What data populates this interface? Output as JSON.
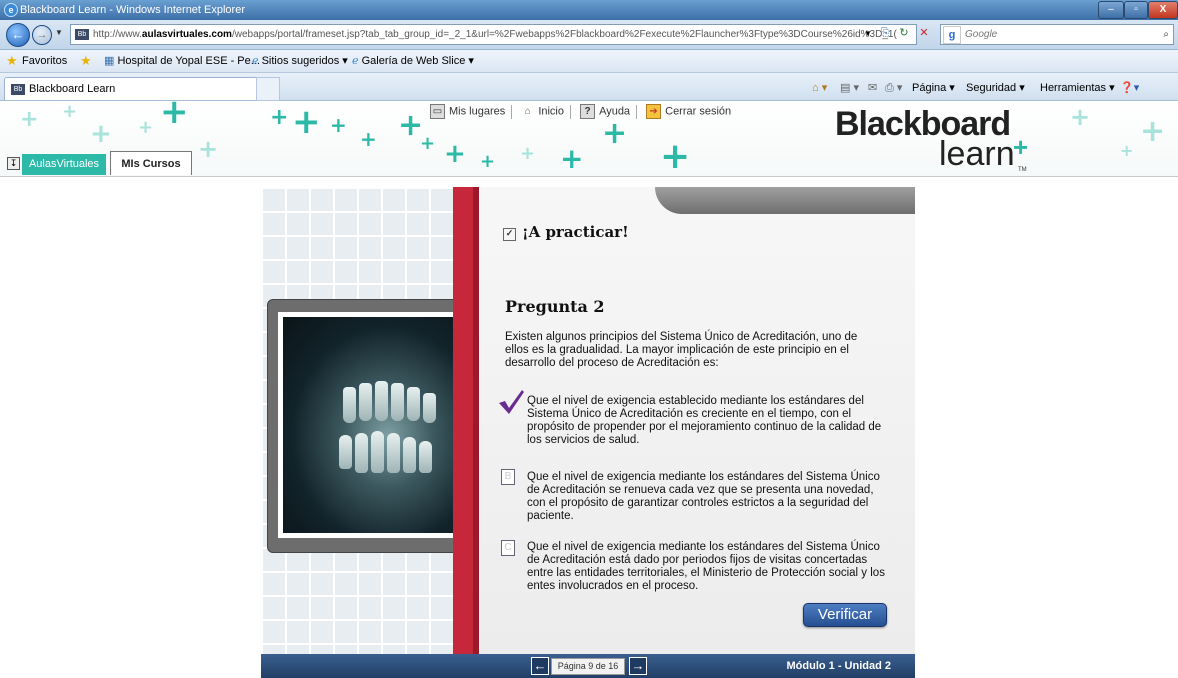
{
  "window": {
    "title": "Blackboard Learn - Windows Internet Explorer",
    "minimize": "–",
    "maximize": "▫",
    "close": "X"
  },
  "address": {
    "url_prefix": "http://www.",
    "url_domain": "aulasvirtuales.com",
    "url_rest": "/webapps/portal/frameset.jsp?tab_tab_group_id=_2_1&url=%2Fwebapps%2Fblackboard%2Fexecute%2Flauncher%3Ftype%3DCourse%26id%3D_1(",
    "search_placeholder": "Google"
  },
  "favorites": {
    "label": "Favoritos",
    "items": [
      "Hospital de Yopal ESE - Pe...",
      "Sitios sugeridos ▾",
      "Galería de Web Slice ▾"
    ]
  },
  "tabs": {
    "active": "Blackboard Learn",
    "commands": [
      "Página ▾",
      "Seguridad ▾",
      "Herramientas ▾"
    ]
  },
  "bb": {
    "links": [
      "Mis lugares",
      "Inicio",
      "Ayuda",
      "Cerrar sesión"
    ],
    "logo_top": "Blackboard",
    "logo_bottom": "learn",
    "logo_tm": "TM",
    "tab_aulas": "AulasVirtuales",
    "tab_cursos": "MIs Cursos"
  },
  "lesson": {
    "heading": "¡A practicar!",
    "question_title": "Pregunta  2",
    "question": "Existen algunos principios del Sistema Único de Acreditación, uno de ellos es la gradualidad. La mayor implicación de este principio en el desarrollo del proceso de Acreditación es:",
    "options": [
      {
        "letter": "A",
        "text": "Que  el nivel de exigencia establecido mediante los estándares del Sistema Único de Acreditación es creciente en el tiempo, con el propósito de propender por el mejoramiento continuo de la calidad de los servicios de salud."
      },
      {
        "letter": "B",
        "text": "Que el nivel de exigencia mediante los estándares del Sistema Único de Acreditación se renueva cada vez que se presenta una novedad, con el propósito de garantizar controles estrictos a la seguridad del paciente."
      },
      {
        "letter": "C",
        "text": "Que el nivel de exigencia mediante los estándares del Sistema Único de Acreditación está dado por periodos fijos de visitas concertadas entre las entidades territoriales, el Ministerio de Protección social y los entes involucrados en el proceso."
      }
    ],
    "selected": "A",
    "verify_button": "Verificar",
    "page": "Página 9 de 16",
    "module": "Módulo 1 - Unidad 2"
  }
}
